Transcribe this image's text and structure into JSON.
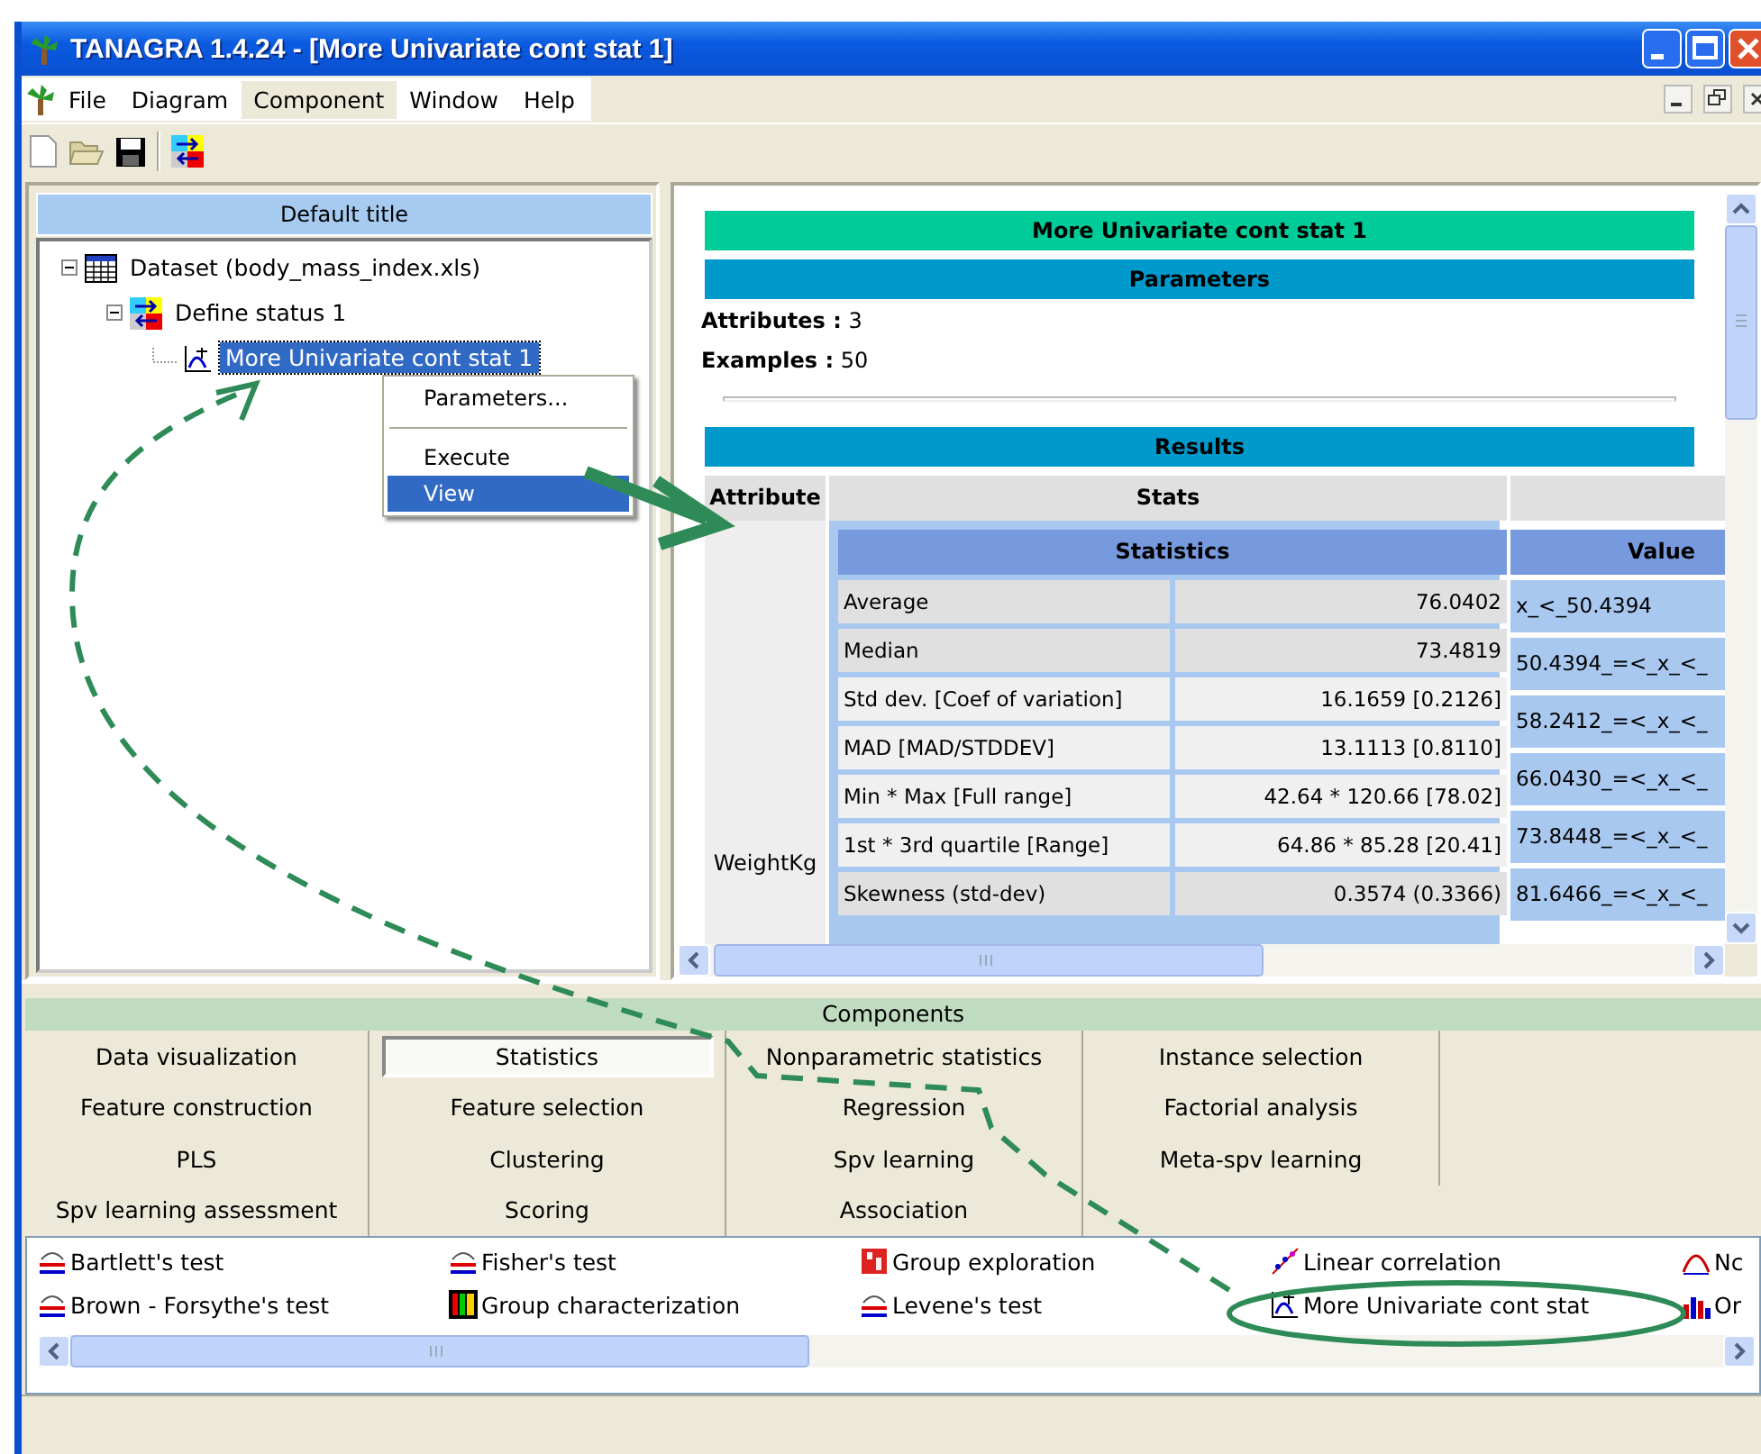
{
  "window": {
    "title": "TANAGRA 1.4.24 - [More Univariate cont stat 1]"
  },
  "menu": [
    {
      "label": "File",
      "selected": false
    },
    {
      "label": "Diagram",
      "selected": false
    },
    {
      "label": "Component",
      "selected": true
    },
    {
      "label": "Window",
      "selected": false
    },
    {
      "label": "Help",
      "selected": false
    }
  ],
  "diagram": {
    "title": "Default title",
    "tree": [
      {
        "label": "Dataset (body_mass_index.xls)",
        "kind": "dataset",
        "expanded": true,
        "selected": false,
        "children": [
          {
            "label": "Define status 1",
            "kind": "status",
            "expanded": true,
            "selected": false,
            "children": [
              {
                "label": "More Univariate cont stat 1",
                "kind": "stat",
                "selected": true
              }
            ]
          }
        ]
      }
    ]
  },
  "context_menu": [
    {
      "kind": "item",
      "label": "Parameters...",
      "selected": false
    },
    {
      "kind": "separator"
    },
    {
      "kind": "item",
      "label": "Execute",
      "selected": false
    },
    {
      "kind": "item",
      "label": "View",
      "selected": true
    }
  ],
  "report": {
    "title": "More Univariate cont stat 1",
    "parameters_heading": "Parameters",
    "parameters": [
      {
        "label": "Attributes :",
        "value": "3"
      },
      {
        "label": "Examples :",
        "value": "50"
      }
    ],
    "results_heading": "Results",
    "columns": [
      "Attribute",
      "Stats"
    ],
    "attribute": "WeightKg",
    "stats_heading": "Statistics",
    "stats": [
      {
        "label": "Average",
        "value": "76.0402",
        "shaded": true
      },
      {
        "label": "Median",
        "value": "73.4819",
        "shaded": true
      },
      {
        "label": "Std dev. [Coef of variation]",
        "value": "16.1659 [0.2126]",
        "shaded": false
      },
      {
        "label": "MAD [MAD/STDDEV]",
        "value": "13.1113 [0.8110]",
        "shaded": false
      },
      {
        "label": "Min * Max [Full range]",
        "value": "42.64 * 120.66 [78.02]",
        "shaded": false
      },
      {
        "label": "1st * 3rd quartile [Range]",
        "value": "64.86 * 85.28 [20.41]",
        "shaded": false
      },
      {
        "label": "Skewness (std-dev)",
        "value": "0.3574 (0.3366)",
        "shaded": true
      }
    ],
    "values_heading": "Value",
    "values": [
      "x_<_50.4394",
      "50.4394_=<_x_<_",
      "58.2412_=<_x_<_",
      "66.0430_=<_x_<_",
      "73.8448_=<_x_<_",
      "81.6466_=<_x_<_"
    ]
  },
  "components": {
    "heading": "Components",
    "tabs": [
      {
        "label": "Data visualization",
        "selected": false
      },
      {
        "label": "Statistics",
        "selected": true
      },
      {
        "label": "Nonparametric statistics",
        "selected": false
      },
      {
        "label": "Instance selection",
        "selected": false
      },
      {
        "label": "Feature construction",
        "selected": false
      },
      {
        "label": "Feature selection",
        "selected": false
      },
      {
        "label": "Regression",
        "selected": false
      },
      {
        "label": "Factorial analysis",
        "selected": false
      },
      {
        "label": "PLS",
        "selected": false
      },
      {
        "label": "Clustering",
        "selected": false
      },
      {
        "label": "Spv learning",
        "selected": false
      },
      {
        "label": "Meta-spv learning",
        "selected": false
      },
      {
        "label": "Spv learning assessment",
        "selected": false
      },
      {
        "label": "Scoring",
        "selected": false
      },
      {
        "label": "Association",
        "selected": false
      }
    ]
  },
  "component_list": [
    [
      {
        "label": "Bartlett's test",
        "kind": "test"
      },
      {
        "label": "Brown - Forsythe's test",
        "kind": "test"
      }
    ],
    [
      {
        "label": "Fisher's test",
        "kind": "test"
      },
      {
        "label": "Group characterization",
        "kind": "bars"
      }
    ],
    [
      {
        "label": "Group exploration",
        "kind": "group"
      },
      {
        "label": "Levene's test",
        "kind": "test"
      }
    ],
    [
      {
        "label": "Linear correlation",
        "kind": "correlation"
      },
      {
        "label": "More Univariate cont stat",
        "kind": "chart"
      }
    ],
    [
      {
        "label": "Nc",
        "kind": "normality"
      },
      {
        "label": "Or",
        "kind": "histogram"
      }
    ]
  ]
}
